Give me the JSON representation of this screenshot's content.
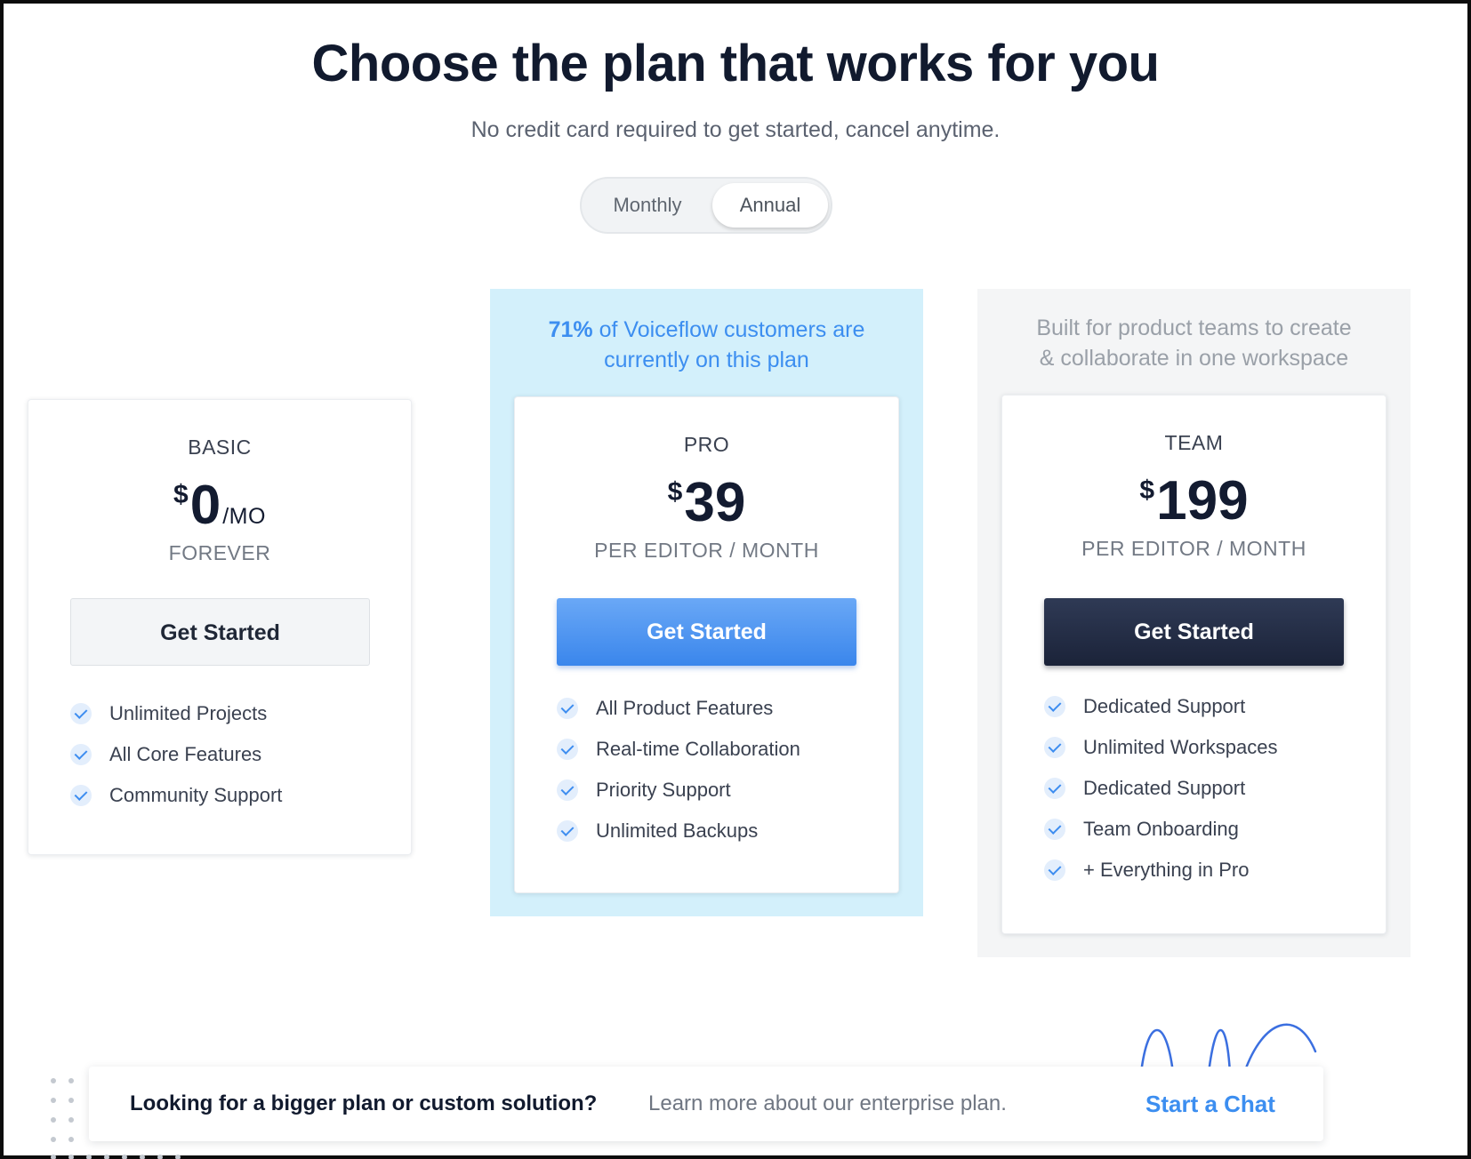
{
  "header": {
    "title": "Choose the plan that works for you",
    "subtitle": "No credit card required to get started, cancel anytime."
  },
  "billing_toggle": {
    "options": [
      "Monthly",
      "Annual"
    ],
    "selected": "Annual"
  },
  "plans": [
    {
      "name": "BASIC",
      "currency": "$",
      "price": "0",
      "price_suffix": "/MO",
      "period": "FOREVER",
      "cta": "Get Started",
      "features": [
        "Unlimited Projects",
        "All Core Features",
        "Community Support"
      ]
    },
    {
      "name": "PRO",
      "currency": "$",
      "price": "39",
      "period": "PER EDITOR / MONTH",
      "cta": "Get Started",
      "blurb_highlight": "71%",
      "blurb_line1_rest": " of Voiceflow customers are",
      "blurb_line2": "currently on this plan",
      "features": [
        "All Product Features",
        "Real-time Collaboration",
        "Priority Support",
        "Unlimited Backups"
      ]
    },
    {
      "name": "TEAM",
      "currency": "$",
      "price": "199",
      "period": "PER EDITOR / MONTH",
      "cta": "Get Started",
      "blurb_line1": "Built for product teams to create",
      "blurb_line2": "& collaborate in one workspace",
      "features": [
        "Dedicated Support",
        "Unlimited Workspaces",
        "Dedicated Support",
        "Team Onboarding",
        "+ Everything in Pro"
      ]
    }
  ],
  "enterprise_banner": {
    "lead": "Looking for a bigger plan or custom solution?",
    "more": "Learn more about our enterprise plan.",
    "cta": "Start a Chat"
  },
  "icons": {
    "feature_check": "check-icon",
    "decoration": "squiggle-icon"
  },
  "colors": {
    "accent_blue": "#3c8ef0",
    "pro_highlight_bg": "#d3f0fb",
    "team_button": "#1f2840",
    "heading": "#111a2e"
  }
}
